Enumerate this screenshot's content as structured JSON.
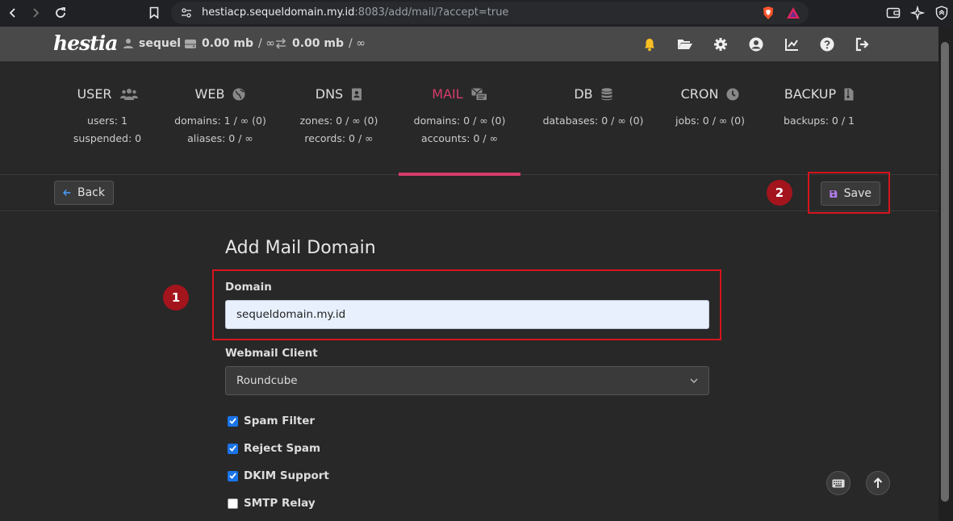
{
  "browser": {
    "url_host": "hestiacp.sequeldomain.my.id",
    "url_path": ":8083/add/mail/?accept=true"
  },
  "topbar": {
    "logo": "hestia",
    "user": "sequel",
    "disk_value": "0.00 mb",
    "disk_unit": "/ ∞",
    "bw_value": "0.00 mb",
    "bw_unit": "/ ∞"
  },
  "tabs": [
    {
      "label": "USER",
      "line1": "users: 1",
      "line2": "suspended: 0",
      "icon": "users-icon"
    },
    {
      "label": "WEB",
      "line1": "domains: 1 / ∞ (0)",
      "line2": "aliases: 0 / ∞",
      "icon": "globe-icon"
    },
    {
      "label": "DNS",
      "line1": "zones: 0 / ∞ (0)",
      "line2": "records: 0 / ∞",
      "icon": "address-book-icon"
    },
    {
      "label": "MAIL",
      "line1": "domains: 0 / ∞ (0)",
      "line2": "accounts: 0 / ∞",
      "icon": "mail-icon"
    },
    {
      "label": "DB",
      "line1": "databases: 0 / ∞ (0)",
      "line2": "",
      "icon": "database-icon"
    },
    {
      "label": "CRON",
      "line1": "jobs: 0 / ∞ (0)",
      "line2": "",
      "icon": "clock-icon"
    },
    {
      "label": "BACKUP",
      "line1": "backups: 0 / 1",
      "line2": "",
      "icon": "file-archive-icon"
    }
  ],
  "active_tab": "MAIL",
  "toolbar": {
    "back_label": "Back",
    "save_label": "Save"
  },
  "annotations": {
    "badge1": "1",
    "badge2": "2",
    "highlight_color": "#d6141d"
  },
  "form": {
    "title": "Add Mail Domain",
    "domain_label": "Domain",
    "domain_value": "sequeldomain.my.id",
    "webmail_label": "Webmail Client",
    "webmail_value": "Roundcube",
    "checks": [
      {
        "label": "Spam Filter",
        "checked": true
      },
      {
        "label": "Reject Spam",
        "checked": true
      },
      {
        "label": "DKIM Support",
        "checked": true
      },
      {
        "label": "SMTP Relay",
        "checked": false
      }
    ]
  },
  "colors": {
    "accent": "#d63c6b",
    "checkbox": "#1a73e8"
  }
}
